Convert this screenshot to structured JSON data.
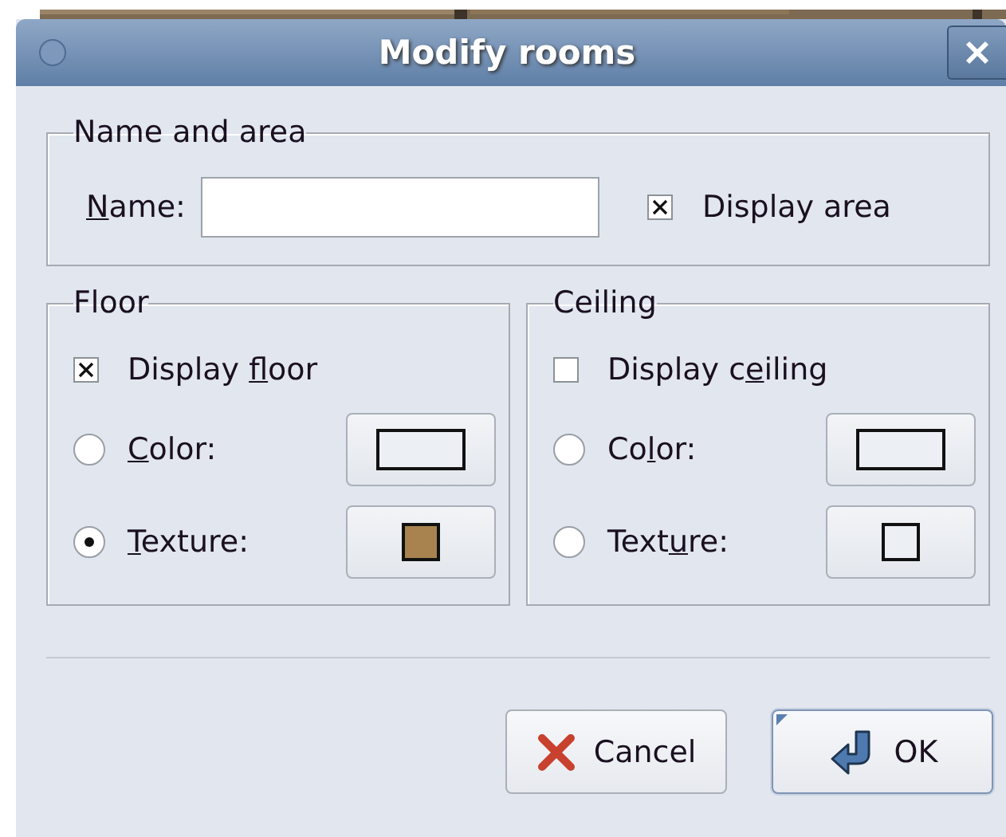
{
  "window": {
    "title": "Modify rooms"
  },
  "name_and_area": {
    "legend": "Name and area",
    "name_label": {
      "key": "N",
      "post": "ame:"
    },
    "display_area": {
      "label": "Display area",
      "checked": true
    }
  },
  "panels": [
    {
      "legend": "Floor",
      "display": {
        "label": {
          "pre": "Display ",
          "key": "f",
          "post": "loor"
        },
        "checked": true
      },
      "options": [
        {
          "kind": "color",
          "label": {
            "key": "C",
            "post": "olor:"
          },
          "selected": false,
          "color": "#eceff4"
        },
        {
          "kind": "texture",
          "label": {
            "key": "T",
            "post": "exture:"
          },
          "selected": true,
          "color": "#a8834f"
        }
      ]
    },
    {
      "legend": "Ceiling",
      "display": {
        "label": {
          "pre": "Display c",
          "key": "e",
          "post": "iling"
        },
        "checked": false
      },
      "options": [
        {
          "kind": "color",
          "label": {
            "pre": "Co",
            "key": "l",
            "post": "or:"
          },
          "selected": false,
          "color": "#eceff4"
        },
        {
          "kind": "texture",
          "label": {
            "pre": "Text",
            "key": "u",
            "post": "re:"
          },
          "selected": false,
          "color": "#eceff4"
        }
      ]
    }
  ],
  "buttons": [
    {
      "kind": "cancel",
      "label": "Cancel",
      "default": false
    },
    {
      "kind": "ok",
      "label": "OK",
      "default": true
    }
  ]
}
